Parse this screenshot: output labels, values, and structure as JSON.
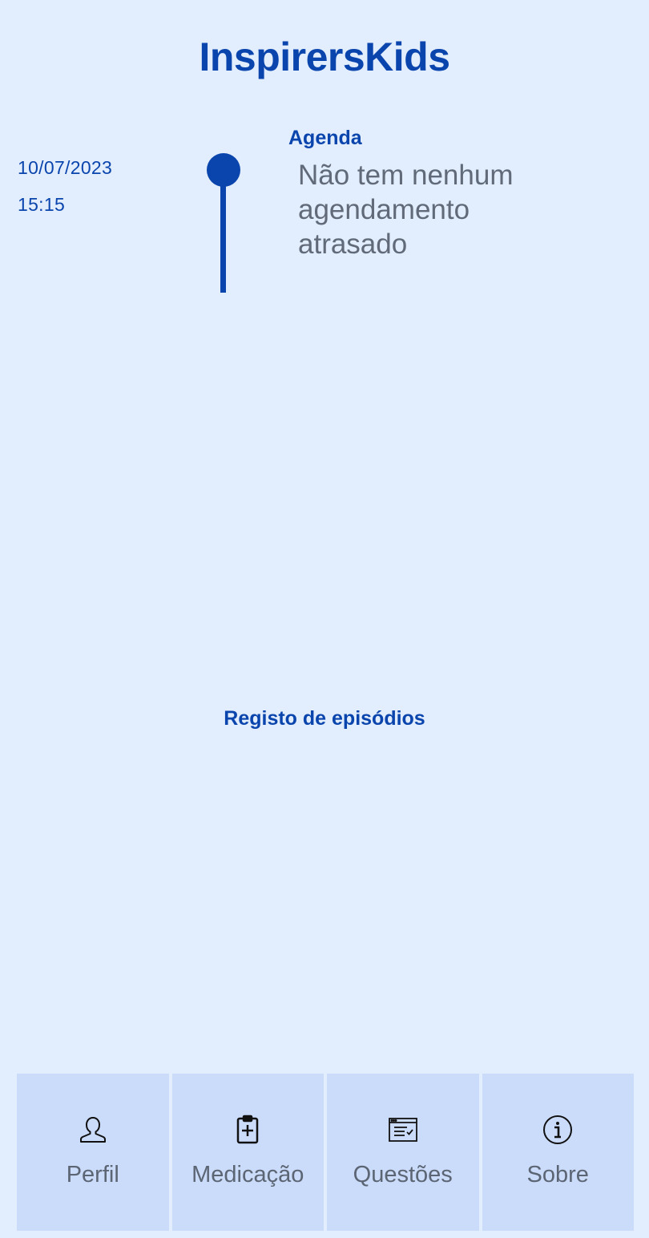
{
  "header": {
    "title": "InspirersKids"
  },
  "agenda": {
    "heading": "Agenda",
    "date": "10/07/2023",
    "time": "15:15",
    "message": "Não tem nenhum agendamento atrasado"
  },
  "episodes": {
    "heading": "Registo de episódios"
  },
  "nav": {
    "items": [
      {
        "label": "Perfil",
        "icon": "person-icon"
      },
      {
        "label": "Medicação",
        "icon": "clipboard-plus-icon"
      },
      {
        "label": "Questões",
        "icon": "checklist-icon"
      },
      {
        "label": "Sobre",
        "icon": "info-icon"
      }
    ]
  },
  "colors": {
    "primary": "#0a45ad",
    "background": "#e2edfd",
    "nav_background": "#cbdcfb",
    "muted_text": "#606a78"
  }
}
